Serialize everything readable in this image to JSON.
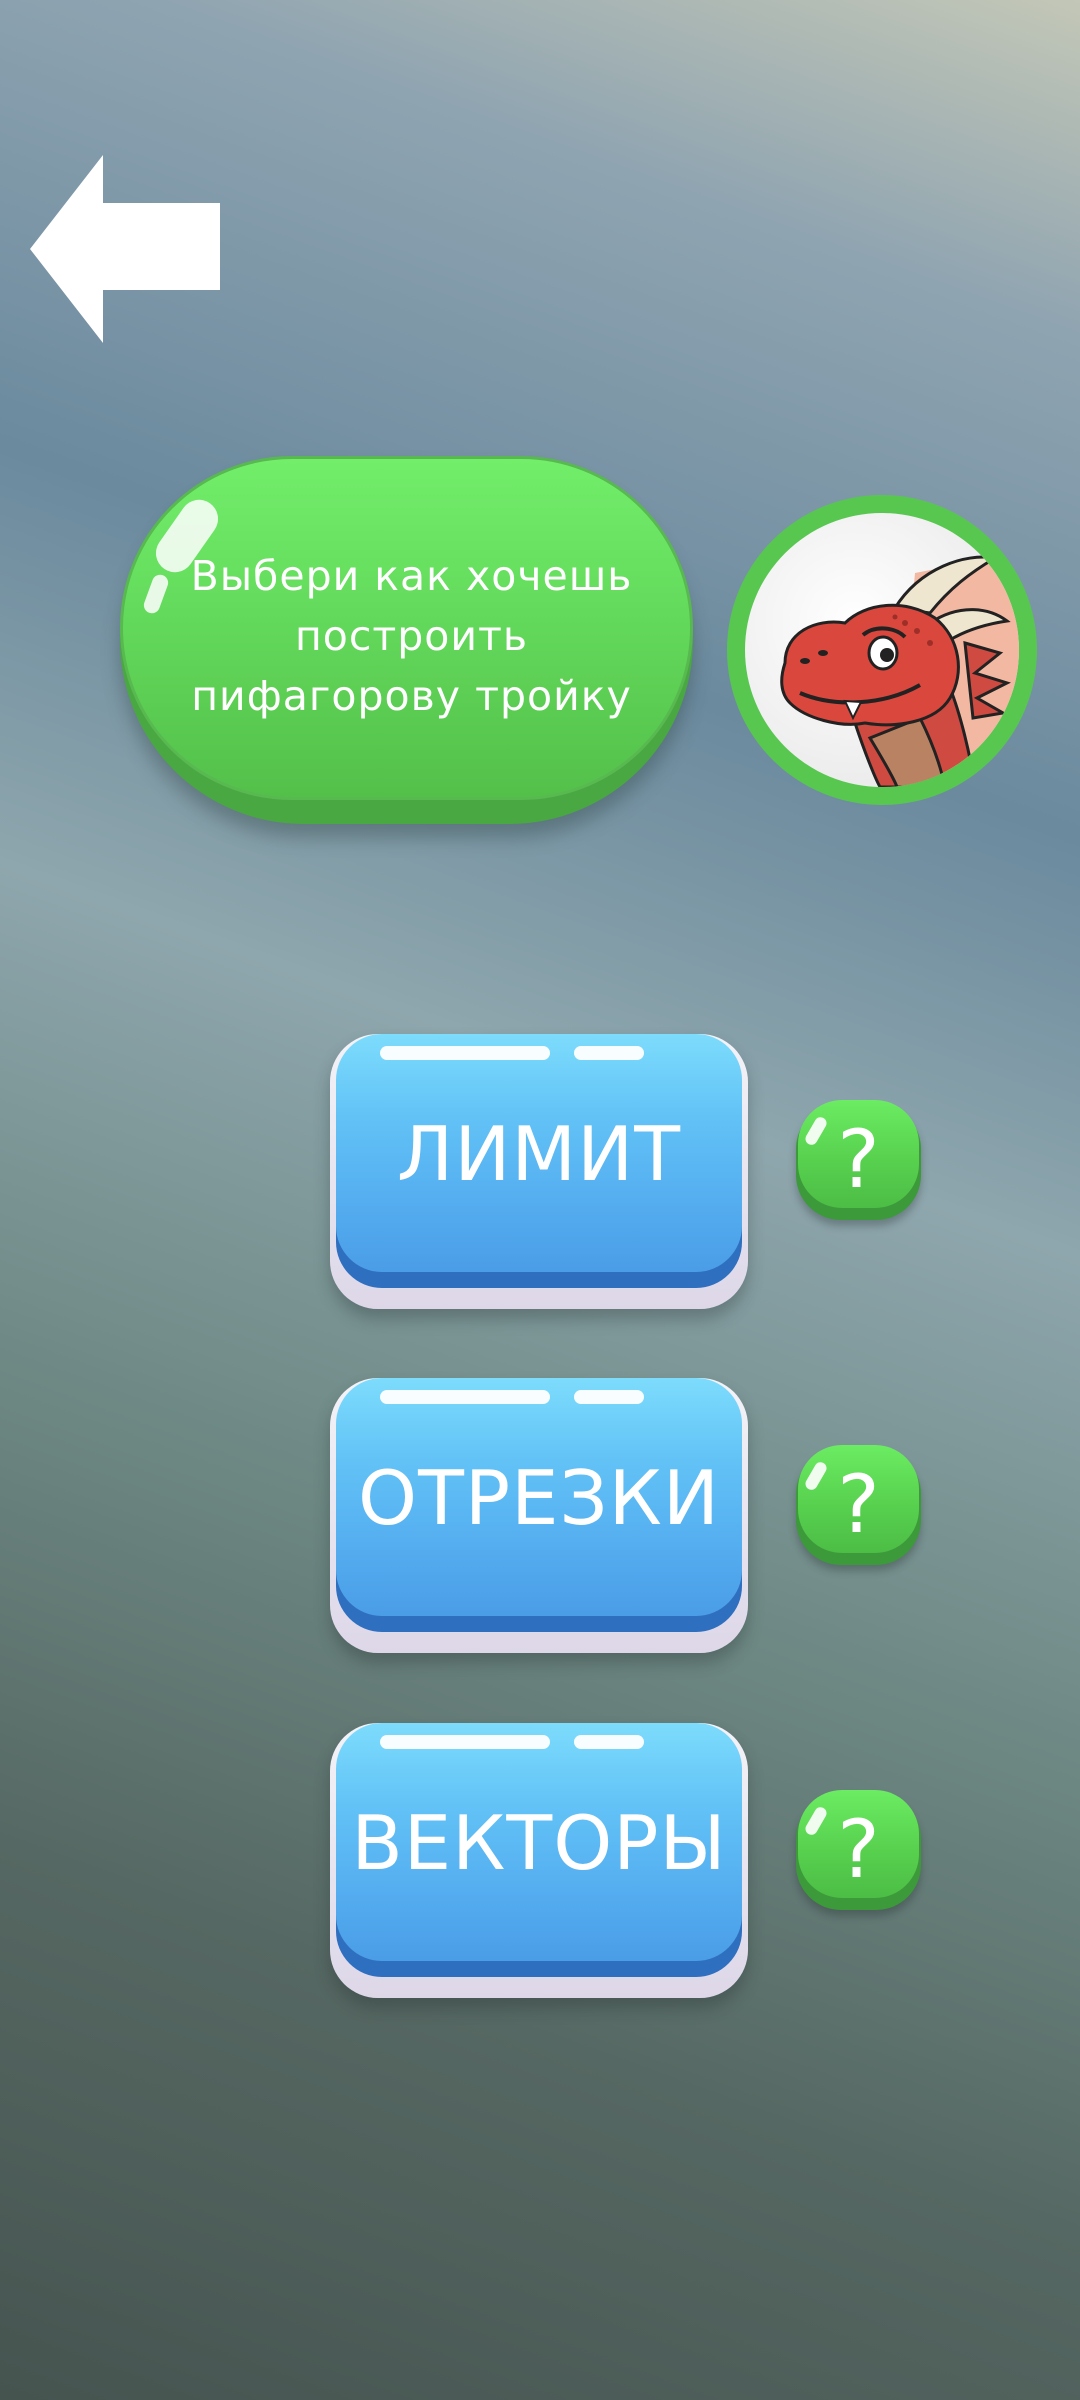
{
  "back": {
    "icon": "back-arrow-icon"
  },
  "prompt": {
    "lines": [
      "Выбери как хочешь",
      "построить",
      "пифагорову тройку"
    ]
  },
  "avatar": {
    "icon": "dragon-mascot-icon"
  },
  "options": [
    {
      "label": "ЛИМИТ",
      "help": "?"
    },
    {
      "label": "ОТРЕЗКИ",
      "help": "?"
    },
    {
      "label": "ВЕКТОРЫ",
      "help": "?"
    }
  ],
  "colors": {
    "primary_button": "#55aef0",
    "speech_bubble": "#62d85a",
    "help_button": "#58d14f"
  }
}
